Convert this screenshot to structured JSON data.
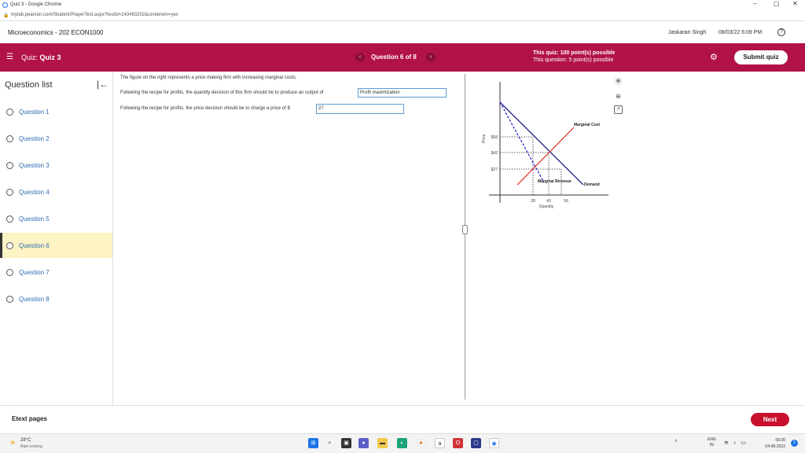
{
  "browser": {
    "window_title": "Quiz 3 - Google Chrome",
    "url": "mylab.pearson.com/Student/PlayerTest.aspx?testId=243463202&centerwin=yes",
    "minimize": "–",
    "maximize": "▢",
    "close": "✕"
  },
  "header": {
    "course": "Microeconomics - 202 ECON1000",
    "user": "Jaskaran Singh",
    "datetime": "08/03/22 6:09 PM",
    "help": "?"
  },
  "quizbar": {
    "quiz_prefix": "Quiz: ",
    "quiz_name": "Quiz 3",
    "question_position": "Question 6 of 8",
    "points_quiz": "This quiz: 100 point(s) possible",
    "points_question": "This question: 5 point(s) possible",
    "submit": "Submit quiz",
    "prev": "‹",
    "next": "›",
    "menu": "☰",
    "settings": "⚙"
  },
  "sidebar": {
    "title": "Question list",
    "collapse": "|←",
    "questions": [
      "Question 1",
      "Question 2",
      "Question 3",
      "Question 4",
      "Question 5",
      "Question 6",
      "Question 7",
      "Question 8"
    ],
    "active_index": 5
  },
  "question": {
    "intro": "The figure on the right represents a price making firm with increasing marginal costs.",
    "line1": "Following the recipe for profits, the quantity decision of this firm should be to produce an output of",
    "answer1": "Profit maximization",
    "line2": "Following the recipe for profits, the price decision should be to charge a price of $",
    "answer2": "27"
  },
  "figure": {
    "ylabel": "Price",
    "xlabel": "Quantity",
    "y_ticks": [
      "$58",
      "$42",
      "$27"
    ],
    "x_ticks": [
      "28",
      "43",
      "56"
    ],
    "labels": {
      "marginal_cost": "Marginal Cost",
      "demand": "Demand",
      "marginal_revenue": "Marginal Revenue"
    },
    "colors": {
      "demand": "#00007a",
      "marginal_cost": "#e02020",
      "marginal_revenue": "#1a1ad0",
      "guides": "#333333"
    }
  },
  "footer": {
    "etext": "Etext pages",
    "next": "Next"
  },
  "taskbar": {
    "temp": "28°C",
    "weather": "Rain coming",
    "lang_1": "ENG",
    "lang_2": "IN",
    "time": "09:30",
    "date": "04-08-2022",
    "tray_arrow": "^",
    "notif": "1"
  }
}
